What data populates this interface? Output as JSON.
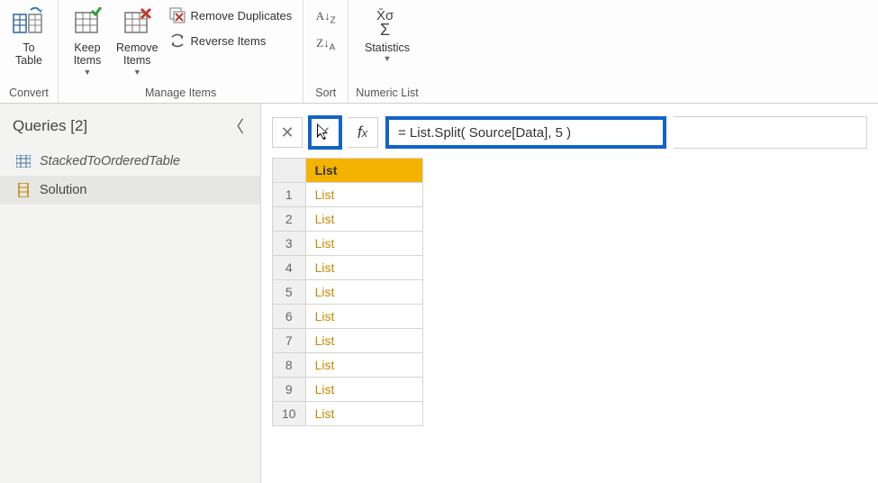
{
  "ribbon": {
    "convert": {
      "to_table": "To\nTable",
      "group_label": "Convert"
    },
    "manage": {
      "keep_items": "Keep\nItems",
      "remove_items": "Remove\nItems",
      "remove_duplicates": "Remove Duplicates",
      "reverse_items": "Reverse Items",
      "group_label": "Manage Items"
    },
    "sort": {
      "group_label": "Sort"
    },
    "numeric": {
      "statistics": "Statistics",
      "group_label": "Numeric List"
    }
  },
  "queries": {
    "header": "Queries [2]",
    "items": [
      {
        "label": "StackedToOrderedTable",
        "type": "table",
        "selected": false
      },
      {
        "label": "Solution",
        "type": "list",
        "selected": true
      }
    ]
  },
  "formula_bar": {
    "fx": "fx",
    "text": "= List.Split( Source[Data], 5 )"
  },
  "grid": {
    "header": "List",
    "rows": [
      {
        "n": 1,
        "val": "List"
      },
      {
        "n": 2,
        "val": "List"
      },
      {
        "n": 3,
        "val": "List"
      },
      {
        "n": 4,
        "val": "List"
      },
      {
        "n": 5,
        "val": "List"
      },
      {
        "n": 6,
        "val": "List"
      },
      {
        "n": 7,
        "val": "List"
      },
      {
        "n": 8,
        "val": "List"
      },
      {
        "n": 9,
        "val": "List"
      },
      {
        "n": 10,
        "val": "List"
      }
    ]
  }
}
